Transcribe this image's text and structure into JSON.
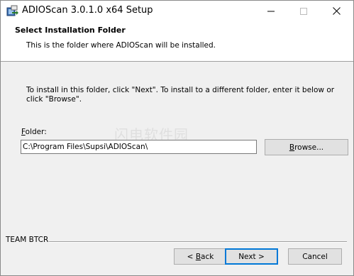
{
  "window": {
    "title": "ADIOScan 3.0.1.0 x64 Setup",
    "icons": {
      "app": "installer-icon",
      "minimize": "minimize-icon",
      "maximize": "maximize-icon",
      "close": "close-icon"
    }
  },
  "banner": {
    "title": "Select Installation Folder",
    "subtitle": "This is the folder where ADIOScan will be installed."
  },
  "main": {
    "instructions": "To install in this folder, click \"Next\". To install to a different folder, enter it below or click \"Browse\".",
    "folder_label_first": "F",
    "folder_label_rest": "older:",
    "folder_value": "C:\\Program Files\\Supsi\\ADIOScan\\",
    "browse_first": "B",
    "browse_rest": "rowse...",
    "watermark": "闪电软件园"
  },
  "footer": {
    "brand": "TEAM BTCR",
    "back_prefix": "< ",
    "back_first": "B",
    "back_rest": "ack",
    "next_label": "Next >",
    "cancel_label": "Cancel"
  },
  "colors": {
    "accent": "#0078d7",
    "window_bg": "#f0f0f0",
    "banner_bg": "#ffffff"
  }
}
